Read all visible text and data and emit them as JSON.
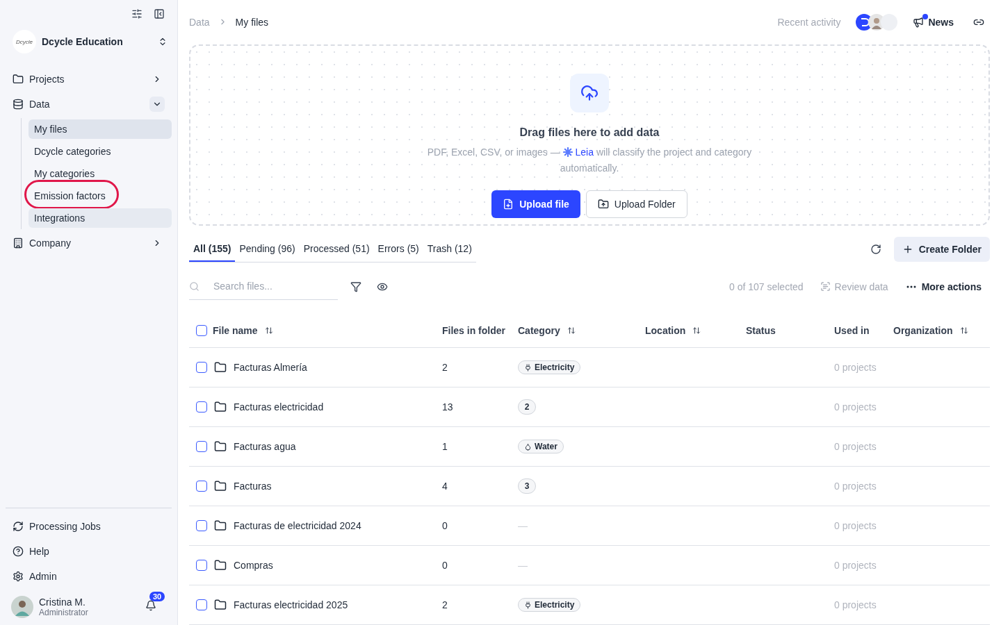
{
  "sidebar": {
    "org": {
      "logo_text": "Dcycle",
      "name": "Dcycle Education"
    },
    "nav": [
      {
        "label": "Projects",
        "kind": "folder",
        "expanded": false
      },
      {
        "label": "Data",
        "kind": "database",
        "expanded": true,
        "children": [
          {
            "label": "My files",
            "selected": true,
            "hovered": false,
            "circled": false
          },
          {
            "label": "Dcycle categories",
            "selected": false,
            "hovered": false,
            "circled": false
          },
          {
            "label": "My categories",
            "selected": false,
            "hovered": false,
            "circled": false
          },
          {
            "label": "Emission factors",
            "selected": false,
            "hovered": false,
            "circled": true
          },
          {
            "label": "Integrations",
            "selected": false,
            "hovered": true,
            "circled": false
          }
        ]
      },
      {
        "label": "Company",
        "kind": "building",
        "expanded": false
      }
    ],
    "footer": [
      {
        "label": "Processing Jobs",
        "kind": "refresh"
      },
      {
        "label": "Help",
        "kind": "help"
      },
      {
        "label": "Admin",
        "kind": "gear"
      }
    ],
    "user": {
      "name": "Cristina M.",
      "role": "Administrator",
      "notifications": "30"
    }
  },
  "breadcrumb": [
    "Data",
    "My files"
  ],
  "topbar": {
    "recent": "Recent activity",
    "news": "News",
    "news_unread": true
  },
  "dropzone": {
    "title": "Drag files here to add data",
    "text_before": "PDF, Excel, CSV, or images —",
    "leia": "Leia",
    "text_after": "will classify the project and category automatically.",
    "primary": "Upload file",
    "secondary": "Upload Folder"
  },
  "tabs": [
    {
      "label": "All",
      "count": "(155)",
      "selected": true
    },
    {
      "label": "Pending",
      "count": "(96)",
      "selected": false
    },
    {
      "label": "Processed",
      "count": "(51)",
      "selected": false
    },
    {
      "label": "Errors",
      "count": "(5)",
      "selected": false
    },
    {
      "label": "Trash",
      "count": "(12)",
      "selected": false
    }
  ],
  "create_folder": "Create Folder",
  "toolbar": {
    "search_placeholder": "Search files...",
    "selection": "0 of 107 selected",
    "review": "Review data",
    "more": "More actions"
  },
  "table": {
    "columns": [
      {
        "label": "File name",
        "sortable": true
      },
      {
        "label": "Files in folder",
        "sortable": false
      },
      {
        "label": "Category",
        "sortable": true
      },
      {
        "label": "Location",
        "sortable": true
      },
      {
        "label": "Status",
        "sortable": false
      },
      {
        "label": "Used in",
        "sortable": false
      },
      {
        "label": "Organization",
        "sortable": true
      }
    ],
    "all_checked": false,
    "rows": [
      {
        "name": "Facturas Almería",
        "files": "2",
        "category": {
          "kind": "plug-tag",
          "text": "Electricity"
        },
        "used_in": "0 projects",
        "checked": false
      },
      {
        "name": "Facturas electricidad",
        "files": "13",
        "category": {
          "kind": "count",
          "text": "2"
        },
        "used_in": "0 projects",
        "checked": false
      },
      {
        "name": "Facturas agua",
        "files": "1",
        "category": {
          "kind": "drop-tag",
          "text": "Water"
        },
        "used_in": "0 projects",
        "checked": false
      },
      {
        "name": "Facturas",
        "files": "4",
        "category": {
          "kind": "count",
          "text": "3"
        },
        "used_in": "0 projects",
        "checked": false
      },
      {
        "name": "Facturas de electricidad 2024",
        "files": "0",
        "category": {
          "kind": "none",
          "text": "—"
        },
        "used_in": "0 projects",
        "checked": false
      },
      {
        "name": "Compras",
        "files": "0",
        "category": {
          "kind": "none",
          "text": "—"
        },
        "used_in": "0 projects",
        "checked": false
      },
      {
        "name": "Facturas electricidad 2025",
        "files": "2",
        "category": {
          "kind": "plug-tag",
          "text": "Electricity"
        },
        "used_in": "0 projects",
        "checked": false
      }
    ]
  }
}
